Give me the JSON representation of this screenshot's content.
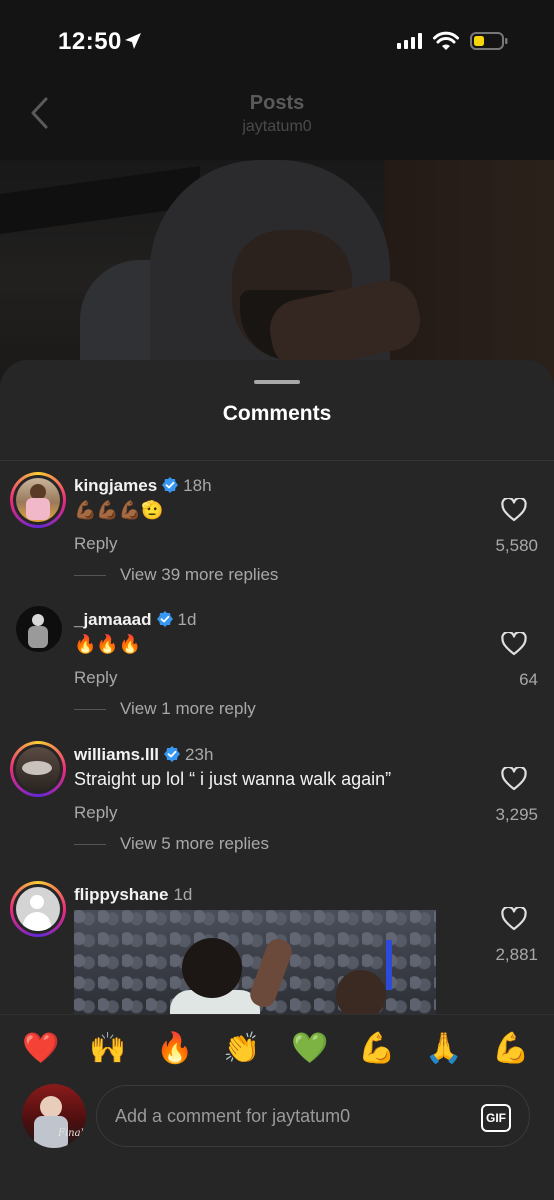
{
  "status_bar": {
    "time": "12:50"
  },
  "header": {
    "title": "Posts",
    "subtitle": "jaytatum0"
  },
  "sheet": {
    "title": "Comments"
  },
  "comments": [
    {
      "username": "kingjames",
      "verified": true,
      "time_ago": "18h",
      "text": "💪🏾💪🏾💪🏾🫡",
      "reply_label": "Reply",
      "view_replies": "View 39 more replies",
      "likes": "5,580",
      "avatar_ring": true
    },
    {
      "username": "_jamaaad",
      "verified": true,
      "time_ago": "1d",
      "text": "🔥🔥🔥",
      "reply_label": "Reply",
      "view_replies": "View 1 more reply",
      "likes": "64",
      "avatar_ring": false
    },
    {
      "username": "williams.lll",
      "verified": true,
      "time_ago": "23h",
      "text": "Straight up lol “ i just wanna walk again”",
      "reply_label": "Reply",
      "view_replies": "View 5 more replies",
      "likes": "3,295",
      "avatar_ring": true
    },
    {
      "username": "flippyshane",
      "verified": false,
      "time_ago": "1d",
      "text": "",
      "likes": "2,881",
      "avatar_ring": true,
      "has_gif": true
    }
  ],
  "emoji_bar": [
    "❤️",
    "🙌",
    "🔥",
    "👏",
    "💚",
    "💪",
    "🙏",
    "💪"
  ],
  "composer": {
    "placeholder": "Add a comment for jaytatum0",
    "gif_label": "GIF",
    "avatar_caption": "Finals"
  },
  "colors": {
    "sheet_bg": "#262626",
    "verified": "#3897f0",
    "secondary_text": "#a8a8a8"
  }
}
